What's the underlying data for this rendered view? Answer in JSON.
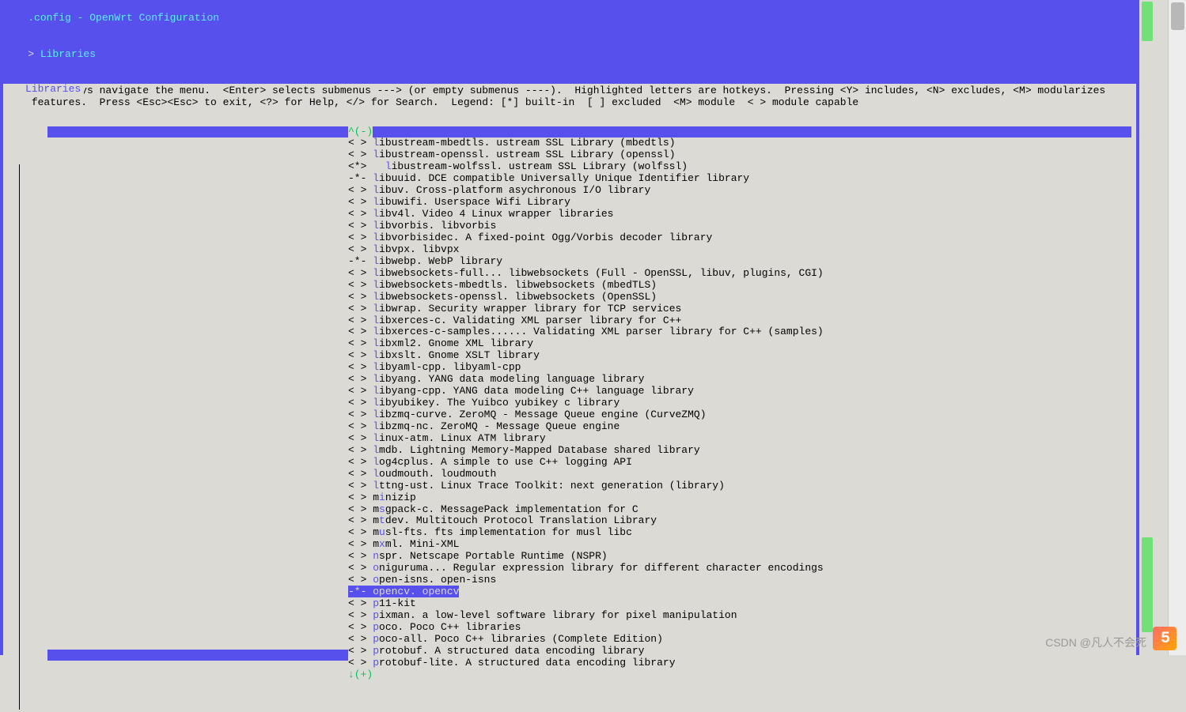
{
  "title": ".config - OpenWrt Configuration",
  "breadcrumb": {
    "arrow": "> ",
    "current": "Libraries"
  },
  "box_title": "Libraries",
  "help_text": " Arrow keys navigate the menu.  <Enter> selects submenus ---> (or empty submenus ----).  Highlighted letters are hotkeys.  Pressing <Y> includes, <N> excludes, <M> modularizes\n features.  Press <Esc><Esc> to exit, <?> for Help, </> for Search.  Legend: [*] built-in  [ ] excluded  <M> module  < > module capable",
  "scroll_up": "^(-)",
  "scroll_down": "↓(+)",
  "items": [
    {
      "prefix": "< > ",
      "hk": "l",
      "rest": "ibustream-mbedtls. ustream SSL Library (mbedtls)"
    },
    {
      "prefix": "< > ",
      "hk": "l",
      "rest": "ibustream-openssl. ustream SSL Library (openssl)"
    },
    {
      "prefix": "<*>   ",
      "hk": "l",
      "rest": "ibustream-wolfssl. ustream SSL Library (wolfssl)"
    },
    {
      "prefix": "-*- ",
      "hk": "l",
      "rest": "ibuuid. DCE compatible Universally Unique Identifier library"
    },
    {
      "prefix": "< > ",
      "hk": "l",
      "rest": "ibuv. Cross-platform asychronous I/O library"
    },
    {
      "prefix": "< > ",
      "hk": "l",
      "rest": "ibuwifi. Userspace Wifi Library"
    },
    {
      "prefix": "< > ",
      "hk": "l",
      "rest": "ibv4l. Video 4 Linux wrapper libraries"
    },
    {
      "prefix": "< > ",
      "hk": "l",
      "rest": "ibvorbis. libvorbis"
    },
    {
      "prefix": "< > ",
      "hk": "l",
      "rest": "ibvorbisidec. A fixed-point Ogg/Vorbis decoder library"
    },
    {
      "prefix": "< > ",
      "hk": "l",
      "rest": "ibvpx. libvpx"
    },
    {
      "prefix": "-*- ",
      "hk": "l",
      "rest": "ibwebp. WebP library"
    },
    {
      "prefix": "< > ",
      "hk": "l",
      "rest": "ibwebsockets-full... libwebsockets (Full - OpenSSL, libuv, plugins, CGI)"
    },
    {
      "prefix": "< > ",
      "hk": "l",
      "rest": "ibwebsockets-mbedtls. libwebsockets (mbedTLS)"
    },
    {
      "prefix": "< > ",
      "hk": "l",
      "rest": "ibwebsockets-openssl. libwebsockets (OpenSSL)"
    },
    {
      "prefix": "< > ",
      "hk": "l",
      "rest": "ibwrap. Security wrapper library for TCP services"
    },
    {
      "prefix": "< > ",
      "hk": "l",
      "rest": "ibxerces-c. Validating XML parser library for C++"
    },
    {
      "prefix": "< > ",
      "hk": "l",
      "rest": "ibxerces-c-samples...... Validating XML parser library for C++ (samples)"
    },
    {
      "prefix": "< > ",
      "hk": "l",
      "rest": "ibxml2. Gnome XML library"
    },
    {
      "prefix": "< > ",
      "hk": "l",
      "rest": "ibxslt. Gnome XSLT library"
    },
    {
      "prefix": "< > ",
      "hk": "l",
      "rest": "ibyaml-cpp. libyaml-cpp"
    },
    {
      "prefix": "< > ",
      "hk": "l",
      "rest": "ibyang. YANG data modeling language library"
    },
    {
      "prefix": "< > ",
      "hk": "l",
      "rest": "ibyang-cpp. YANG data modeling C++ language library"
    },
    {
      "prefix": "< > ",
      "hk": "l",
      "rest": "ibyubikey. The Yuibco yubikey c library"
    },
    {
      "prefix": "< > ",
      "hk": "l",
      "rest": "ibzmq-curve. ZeroMQ - Message Queue engine (CurveZMQ)"
    },
    {
      "prefix": "< > ",
      "hk": "l",
      "rest": "ibzmq-nc. ZeroMQ - Message Queue engine"
    },
    {
      "prefix": "< > ",
      "hk": "l",
      "rest": "inux-atm. Linux ATM library"
    },
    {
      "prefix": "< > ",
      "hk": "l",
      "rest": "mdb. Lightning Memory-Mapped Database shared library"
    },
    {
      "prefix": "< > ",
      "hk": "l",
      "rest": "og4cplus. A simple to use C++ logging API"
    },
    {
      "prefix": "< > ",
      "hk": "l",
      "rest": "oudmouth. loudmouth"
    },
    {
      "prefix": "< > ",
      "hk": "l",
      "rest": "ttng-ust. Linux Trace Toolkit: next generation (library)"
    },
    {
      "prefix": "< > m",
      "hk": "i",
      "rest": "nizip"
    },
    {
      "prefix": "< > m",
      "hk": "s",
      "rest": "gpack-c. MessagePack implementation for C"
    },
    {
      "prefix": "< > m",
      "hk": "t",
      "rest": "dev. Multitouch Protocol Translation Library"
    },
    {
      "prefix": "< > m",
      "hk": "u",
      "rest": "sl-fts. fts implementation for musl libc"
    },
    {
      "prefix": "< > m",
      "hk": "x",
      "rest": "ml. Mini-XML"
    },
    {
      "prefix": "< > ",
      "hk": "n",
      "rest": "spr. Netscape Portable Runtime (NSPR)"
    },
    {
      "prefix": "< > ",
      "hk": "o",
      "rest": "niguruma... Regular expression library for different character encodings"
    },
    {
      "prefix": "< > ",
      "hk": "o",
      "rest": "pen-isns. open-isns"
    },
    {
      "prefix": "-*- ",
      "hk": "o",
      "rest": "pencv. opencv",
      "selected": true
    },
    {
      "prefix": "< > ",
      "hk": "p",
      "rest": "11-kit"
    },
    {
      "prefix": "< > ",
      "hk": "p",
      "rest": "ixman. a low-level software library for pixel manipulation"
    },
    {
      "prefix": "< > ",
      "hk": "p",
      "rest": "oco. Poco C++ libraries"
    },
    {
      "prefix": "< > ",
      "hk": "p",
      "rest": "oco-all. Poco C++ libraries (Complete Edition)"
    },
    {
      "prefix": "< > ",
      "hk": "p",
      "rest": "rotobuf. A structured data encoding library"
    },
    {
      "prefix": "< > ",
      "hk": "p",
      "rest": "rotobuf-lite. A structured data encoding library"
    }
  ],
  "watermark": "CSDN @凡人不会死"
}
